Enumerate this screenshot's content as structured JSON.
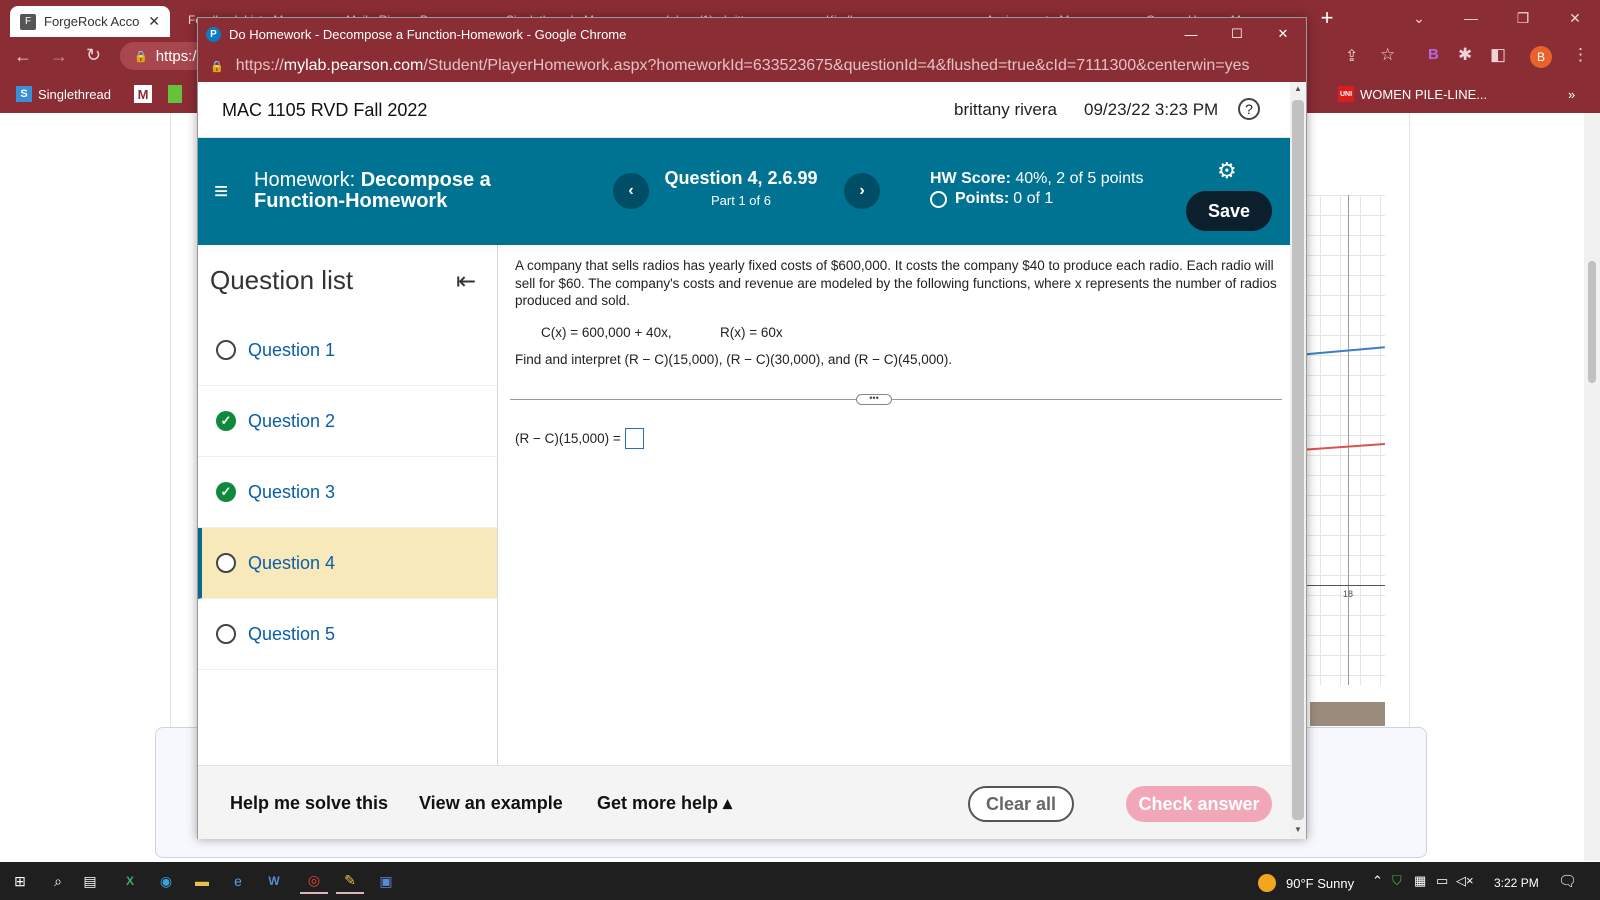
{
  "browser": {
    "tabs": {
      "active": "ForgeRock Acco",
      "others": [
        "Feedback List - M...",
        "Mail - Rivera, B...",
        "Singlethread - M...",
        "Inbox (1) - brittany...",
        "Kindle",
        "Assignment - M...",
        "Course Home - M..."
      ]
    },
    "address_partial": "https:/",
    "bookmarks": {
      "singlethread": "Singlethread",
      "women": "WOMEN PILE-LINE...",
      "more": "»"
    },
    "profile_letter": "B"
  },
  "popup": {
    "title": "Do Homework - Decompose a Function-Homework - Google Chrome",
    "url_prefix": "https://",
    "url_domain": "mylab.pearson.com",
    "url_rest": "/Student/PlayerHomework.aspx?homeworkId=633523675&questionId=4&flushed=true&cId=7111300&centerwin=yes"
  },
  "header": {
    "course": "MAC 1105 RVD Fall 2022",
    "user": "brittany rivera",
    "datetime": "09/23/22 3:23 PM",
    "help_glyph": "?"
  },
  "banner": {
    "hw_prefix": "Homework:",
    "hw_name_line1": "Decompose a",
    "hw_name_line2": "Function-Homework",
    "question_title": "Question 4, 2.6.99",
    "part": "Part 1 of 6",
    "hw_score_label": "HW Score:",
    "hw_score_value": "40%, 2 of 5 points",
    "points_label": "Points:",
    "points_value": "0 of 1",
    "save_label": "Save"
  },
  "question_list": {
    "heading": "Question list",
    "items": [
      {
        "label": "Question 1",
        "status": "unanswered"
      },
      {
        "label": "Question 2",
        "status": "correct"
      },
      {
        "label": "Question 3",
        "status": "correct"
      },
      {
        "label": "Question 4",
        "status": "current"
      },
      {
        "label": "Question 5",
        "status": "unanswered"
      }
    ]
  },
  "question": {
    "text": "A company that sells radios has yearly fixed costs of $600,000. It costs the company $40 to produce each radio. Each radio will sell for $60. The company's costs and revenue are modeled by the following functions, where x represents the number of radios produced and sold.",
    "cost_fn": "C(x) = 600,000 + 40x,",
    "revenue_fn": "R(x) = 60x",
    "instruction": "Find and interpret (R − C)(15,000), (R − C)(30,000), and (R − C)(45,000).",
    "answer_prefix": "(R − C)(15,000) =",
    "answer_value": ""
  },
  "footer": {
    "help_solve": "Help me solve this",
    "view_example": "View an example",
    "more_help": "Get more help ▴",
    "clear_all": "Clear all",
    "check_answer": "Check answer"
  },
  "background_page": {
    "axis_label": "18"
  },
  "taskbar": {
    "weather": "90°F  Sunny",
    "time": "3:22 PM"
  },
  "colors": {
    "chrome": "#8b2d34",
    "banner": "#007392",
    "current_question": "#f8e9bb",
    "correct": "#0f8a3d",
    "link": "#0a5ea8",
    "check_answer_disabled": "#f2a7b8"
  }
}
